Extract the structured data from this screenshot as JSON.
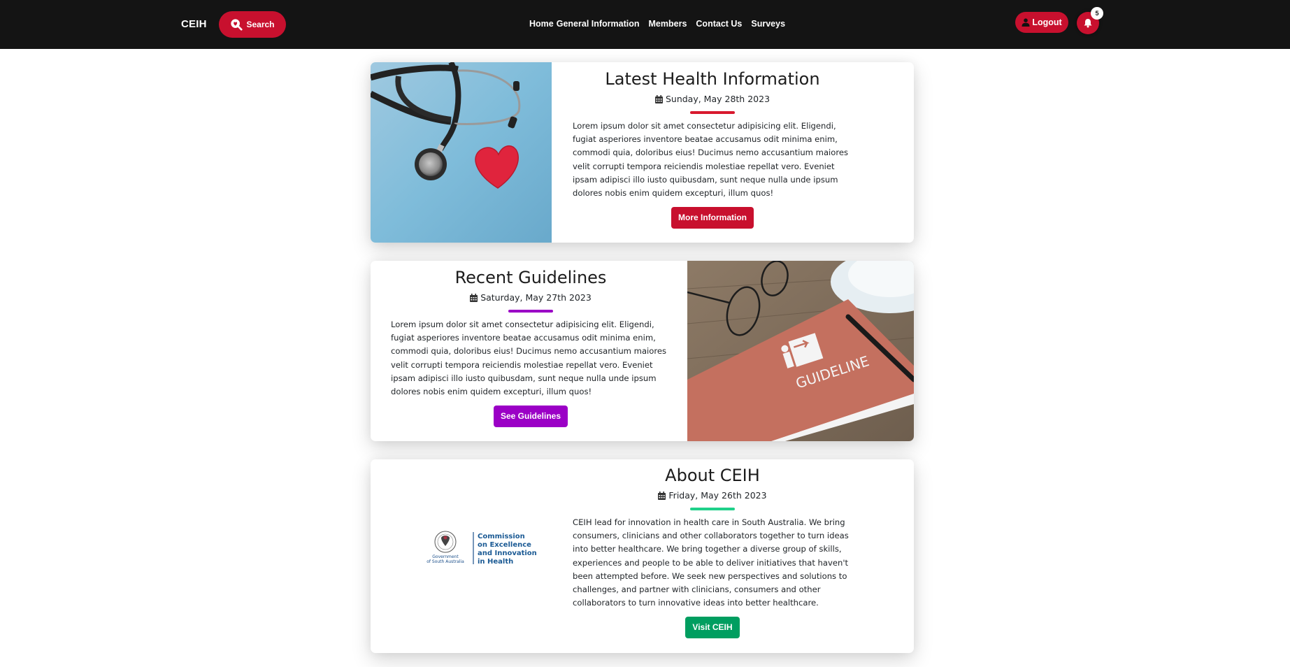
{
  "navbar": {
    "brand": "CEIH",
    "search_label": "Search",
    "links": [
      "Home",
      "General Information",
      "Members",
      "Contact Us",
      "Surveys"
    ],
    "logout_label": "Logout",
    "notification_count": "5",
    "accent_color": "#c8102e"
  },
  "cards": [
    {
      "title": "Latest Health Information",
      "date": "Sunday, May 28th 2023",
      "accent_color": "#c8102e",
      "text": "Lorem ipsum dolor sit amet consectetur adipisicing elit. Eligendi, fugiat asperiores inventore beatae accusamus odit minima enim, commodi quia, doloribus eius! Ducimus nemo accusantium maiores velit corrupti tempora reiciendis molestiae repellat vero. Eveniet ipsam adipisci illo iusto quibusdam, sunt neque nulla unde ipsum dolores nobis enim quidem excepturi, illum quos!",
      "button_label": "More Information",
      "image": "stethoscope-and-heart"
    },
    {
      "title": "Recent Guidelines",
      "date": "Saturday, May 27th 2023",
      "accent_color": "#9b00c6",
      "text": "Lorem ipsum dolor sit amet consectetur adipisicing elit. Eligendi, fugiat asperiores inventore beatae accusamus odit minima enim, commodi quia, doloribus eius! Ducimus nemo accusantium maiores velit corrupti tempora reiciendis molestiae repellat vero. Eveniet ipsam adipisci illo iusto quibusdam, sunt neque nulla unde ipsum dolores nobis enim quidem excepturi, illum quos!",
      "button_label": "See Guidelines",
      "image": "guideline-book",
      "image_text": "GUIDELINE"
    },
    {
      "title": "About CEIH",
      "date": "Friday, May 26th 2023",
      "accent_color": "#1fd08a",
      "button_color": "#009e60",
      "text": "CEIH lead for innovation in health care in South Australia. We bring consumers, clinicians and other collaborators together to turn ideas into better healthcare. We bring together a diverse group of skills, experiences and people to be able to deliver initiatives that haven't been attempted before. We seek new perspectives and solutions to challenges, and partner with clinicians, consumers and other collaborators to turn innovative ideas into better healthcare.",
      "button_label": "Visit CEIH",
      "logo": {
        "gov_line1": "Government",
        "gov_line2": "of South Australia",
        "lines": [
          "Commission",
          "on Excellence",
          "and Innovation",
          "in Health"
        ]
      }
    }
  ]
}
